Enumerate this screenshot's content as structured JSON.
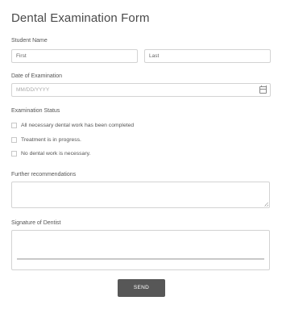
{
  "form": {
    "title": "Dental Examination Form",
    "student_name": {
      "label": "Student Name",
      "first_placeholder": "First",
      "last_placeholder": "Last"
    },
    "exam_date": {
      "label": "Date of Examination",
      "placeholder": "MM/DD/YYYY",
      "icon": "calendar-icon"
    },
    "exam_status": {
      "label": "Examination Status",
      "options": [
        "All necessary dental work has been completed",
        "Treatment is in progress.",
        "No dental work is necessary."
      ]
    },
    "recommendations": {
      "label": "Further recommendations"
    },
    "signature": {
      "label": "Signature of Dentist"
    },
    "send_label": "SEND"
  }
}
